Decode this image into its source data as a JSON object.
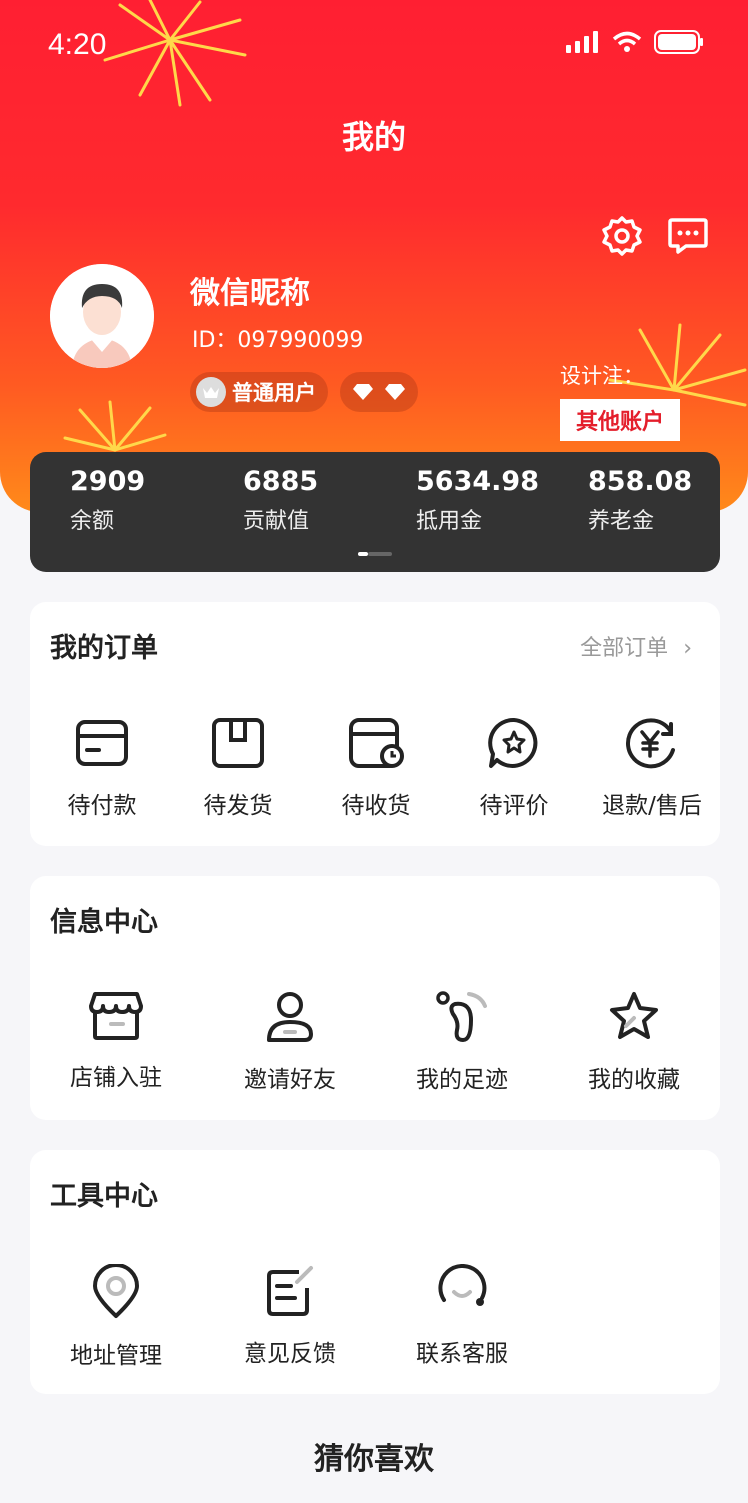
{
  "status_bar": {
    "time": "4:20"
  },
  "header": {
    "title": "我的",
    "settings_icon": "gear-icon",
    "message_icon": "chat-icon"
  },
  "profile": {
    "nickname": "微信昵称",
    "id_text": "ID：097990099",
    "level_badge": "普通用户",
    "design_note": "设计注：",
    "other_account": "其他账户"
  },
  "stats": [
    {
      "value": "2909",
      "label": "余额"
    },
    {
      "value": "6885",
      "label": "贡献值"
    },
    {
      "value": "5634.98",
      "label": "抵用金"
    },
    {
      "value": "858.08",
      "label": "养老金"
    }
  ],
  "orders": {
    "title": "我的订单",
    "all_link": "全部订单",
    "items": [
      {
        "label": "待付款",
        "icon": "card-icon"
      },
      {
        "label": "待发货",
        "icon": "box-icon"
      },
      {
        "label": "待收货",
        "icon": "delivery-icon"
      },
      {
        "label": "待评价",
        "icon": "review-icon"
      },
      {
        "label": "退款/售后",
        "icon": "refund-icon"
      }
    ]
  },
  "info_center": {
    "title": "信息中心",
    "items": [
      {
        "label": "店铺入驻",
        "icon": "store-icon"
      },
      {
        "label": "邀请好友",
        "icon": "user-icon"
      },
      {
        "label": "我的足迹",
        "icon": "footprint-icon"
      },
      {
        "label": "我的收藏",
        "icon": "star-icon"
      }
    ]
  },
  "tool_center": {
    "title": "工具中心",
    "items": [
      {
        "label": "地址管理",
        "icon": "location-icon"
      },
      {
        "label": "意见反馈",
        "icon": "feedback-icon"
      },
      {
        "label": "联系客服",
        "icon": "headset-icon"
      }
    ]
  },
  "recommend_title": "猜你喜欢",
  "colors": {
    "primary_red": "#ff1f32",
    "orange": "#ff8a1a",
    "dark_card": "#333333"
  }
}
